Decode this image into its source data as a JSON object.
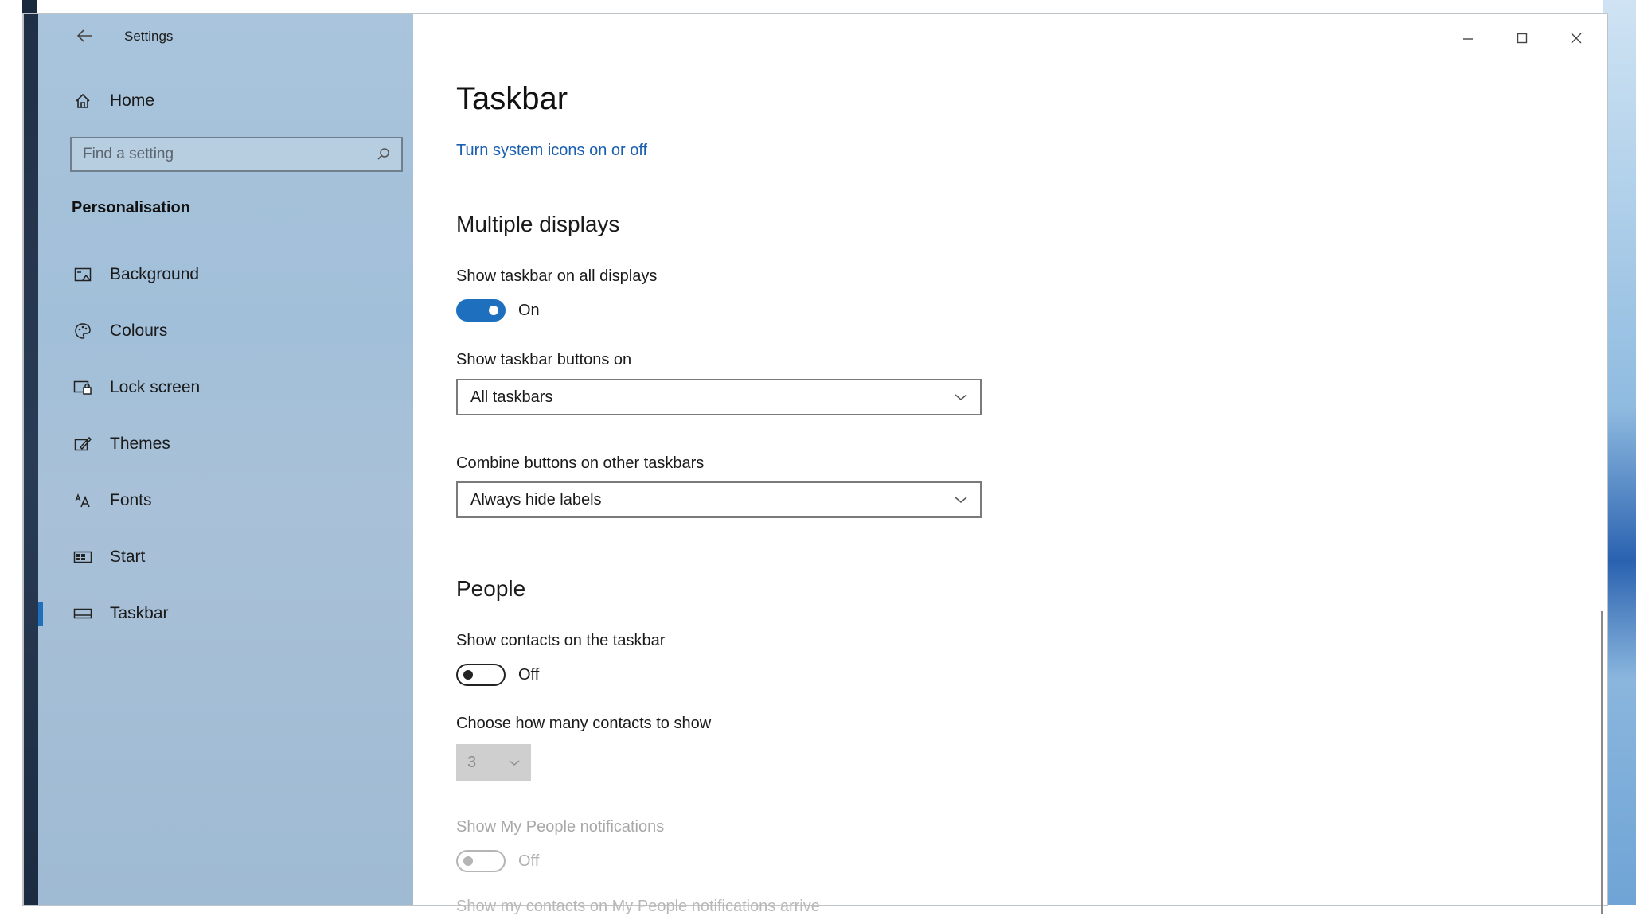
{
  "window": {
    "title": "Settings",
    "controls": {
      "minimize": "−",
      "maximize": "☐",
      "close": "✕"
    }
  },
  "sidebar": {
    "back_icon": "back-arrow-icon",
    "home": {
      "label": "Home",
      "icon": "home-icon"
    },
    "search": {
      "placeholder": "Find a setting",
      "icon": "search-icon"
    },
    "section": "Personalisation",
    "items": [
      {
        "label": "Background",
        "icon": "background-image-icon"
      },
      {
        "label": "Colours",
        "icon": "palette-icon"
      },
      {
        "label": "Lock screen",
        "icon": "lock-screen-icon"
      },
      {
        "label": "Themes",
        "icon": "themes-icon"
      },
      {
        "label": "Fonts",
        "icon": "fonts-icon"
      },
      {
        "label": "Start",
        "icon": "start-icon"
      },
      {
        "label": "Taskbar",
        "icon": "taskbar-icon",
        "selected": true
      }
    ],
    "accent_color": "#1f6fbf"
  },
  "main": {
    "title": "Taskbar",
    "link": "Turn system icons on or off",
    "multiple_displays": {
      "heading": "Multiple displays",
      "show_all_label": "Show taskbar on all displays",
      "show_all_state": "On",
      "buttons_on_label": "Show taskbar buttons on",
      "buttons_on_value": "All taskbars",
      "combine_label": "Combine buttons on other taskbars",
      "combine_value": "Always hide labels"
    },
    "people": {
      "heading": "People",
      "show_contacts_label": "Show contacts on the taskbar",
      "show_contacts_state": "Off",
      "how_many_label": "Choose how many contacts to show",
      "how_many_value": "3",
      "notifications_label": "Show My People notifications",
      "notifications_state": "Off",
      "cutoff_label": "Show my contacts on My People notifications arrive"
    }
  }
}
